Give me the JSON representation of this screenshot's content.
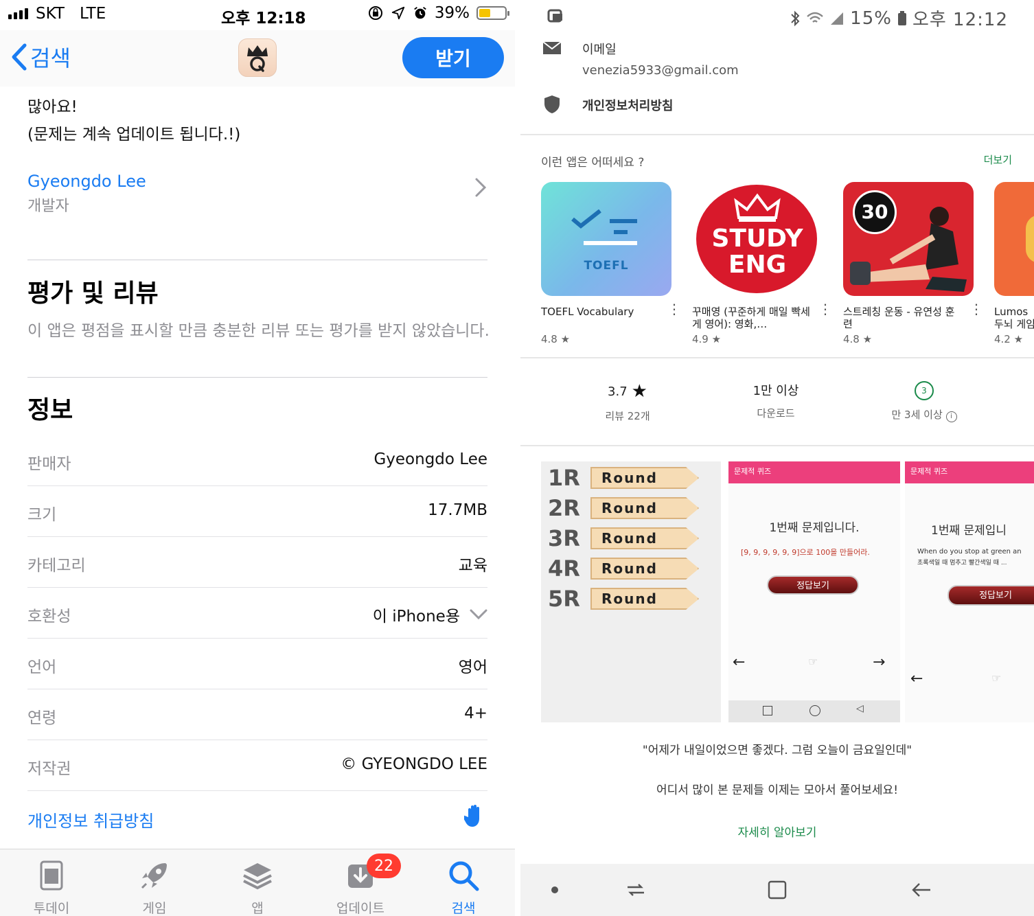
{
  "left": {
    "status_bar": {
      "carrier": "SKT",
      "network": "LTE",
      "time": "오후 12:18",
      "battery": "39%"
    },
    "nav": {
      "back_label": "검색",
      "get_button": "받기"
    },
    "description": {
      "line1": "많아요!",
      "line2": "(문제는 계속 업데이트 됩니다.!)"
    },
    "developer": {
      "name": "Gyeongdo Lee",
      "label": "개발자"
    },
    "ratings": {
      "title": "평가 및 리뷰",
      "note": "이 앱은 평점을 표시할 만큼 충분한 리뷰 또는 평가를 받지 않았습니다."
    },
    "info": {
      "title": "정보",
      "rows": [
        {
          "key": "판매자",
          "value": "Gyeongdo Lee"
        },
        {
          "key": "크기",
          "value": "17.7MB"
        },
        {
          "key": "카테고리",
          "value": "교육"
        },
        {
          "key": "호환성",
          "value": "이 iPhone용"
        },
        {
          "key": "언어",
          "value": "영어"
        },
        {
          "key": "연령",
          "value": "4+"
        },
        {
          "key": "저작권",
          "value": "© GYEONGDO LEE"
        }
      ],
      "privacy_link": "개인정보 취급방침"
    },
    "tabbar": {
      "tabs": [
        {
          "label": "투데이",
          "icon": "today-icon"
        },
        {
          "label": "게임",
          "icon": "rocket-icon"
        },
        {
          "label": "앱",
          "icon": "layers-icon"
        },
        {
          "label": "업데이트",
          "icon": "download-icon",
          "badge": "22"
        },
        {
          "label": "검색",
          "icon": "search-icon",
          "active": true
        }
      ]
    },
    "colors": {
      "accent": "#1a7cf2",
      "badge": "#ff3b30"
    }
  },
  "right": {
    "status_bar": {
      "battery": "15%",
      "time": "오후 12:12"
    },
    "contact": {
      "email_label": "이메일",
      "email": "venezia5933@gmail.com",
      "privacy_label": "개인정보처리방침"
    },
    "similar": {
      "heading": "이런 앱은 어떠세요 ?",
      "more": "더보기",
      "apps": [
        {
          "name": "TOEFL Vocabulary",
          "rating": "4.8 ★",
          "icon_text": "TOEFL"
        },
        {
          "name": "꾸매영 (꾸준하게 매일 빡세게 영어): 영화,…",
          "rating": "4.9 ★",
          "icon_text1": "STUDY",
          "icon_text2": "ENG"
        },
        {
          "name": "스트레칭 운동 - 유연성 훈련",
          "rating": "4.8 ★",
          "icon_text": "30"
        },
        {
          "name": "Lumos 두뇌 게임",
          "rating": "4.2 ★"
        }
      ]
    },
    "stats": {
      "rating": "3.7",
      "reviews": "리뷰 22개",
      "downloads": "1만 이상",
      "downloads_label": "다운로드",
      "age_badge": "3",
      "age_label": "만 3세 이상"
    },
    "screenshots": {
      "rounds": [
        {
          "n": "1R",
          "label": "Round"
        },
        {
          "n": "2R",
          "label": "Round"
        },
        {
          "n": "3R",
          "label": "Round"
        },
        {
          "n": "4R",
          "label": "Round"
        },
        {
          "n": "5R",
          "label": "Round"
        }
      ],
      "shot2": {
        "header": "문제적 퀴즈",
        "title": "1번째 문제입니다.",
        "sub": "[9, 9, 9, 9, 9, 9]으로 100을 만들어라.",
        "button": "정답보기"
      },
      "shot3": {
        "header": "문제적 퀴즈",
        "title": "1번째 문제입니",
        "sub1": "When do you stop at green an",
        "sub2": "초록색일 때 멈추고 빨간색일 때 ...",
        "button": "정답보기"
      }
    },
    "quote1": "\"어제가 내일이었으면 좋겠다. 그럼 오늘이 금요일인데\"",
    "quote2": "어디서 많이 본 문제들 이제는 모아서 풀어보세요!",
    "learn_more": "자세히 알아보기",
    "colors": {
      "accent": "#1a8a4a",
      "quiz_pink": "#ec3f7c"
    }
  }
}
